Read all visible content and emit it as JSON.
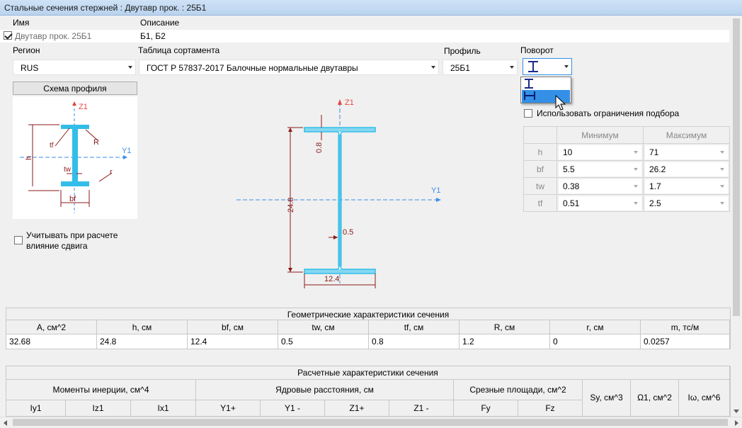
{
  "window": {
    "title": "Стальные сечения стержней : Двутавр прок. : 25Б1"
  },
  "fields": {
    "name_label": "Имя",
    "desc_label": "Описание",
    "name_value": "Двутавр прок. 25Б1",
    "desc_value": "Б1, Б2"
  },
  "region": {
    "label": "Регион",
    "value": "RUS"
  },
  "table": {
    "label": "Таблица сортамента",
    "value": "ГОСТ Р 57837-2017 Балочные нормальные двутавры"
  },
  "profile": {
    "label": "Профиль",
    "value": "25Б1"
  },
  "rotation": {
    "label": "Поворот"
  },
  "scheme": {
    "button": "Схема профиля",
    "z": "Z1",
    "y": "Y1",
    "h": "h",
    "tf": "tf",
    "tw": "tw",
    "R": "R",
    "r": "r",
    "bf": "bf"
  },
  "drawing": {
    "z": "Z1",
    "y": "Y1",
    "flange": "0.8",
    "height": "24.8",
    "web": "0.5",
    "width": "12.4"
  },
  "shear": {
    "label1": "Учитывать при расчете",
    "label2": "влияние сдвига"
  },
  "limits": {
    "use_label": "Использовать ограничения подбора",
    "min_header": "Минимум",
    "max_header": "Максимум",
    "rows": [
      {
        "name": "h",
        "min": "10",
        "max": "71"
      },
      {
        "name": "bf",
        "min": "5.5",
        "max": "26.2"
      },
      {
        "name": "tw",
        "min": "0.38",
        "max": "1.7"
      },
      {
        "name": "tf",
        "min": "0.51",
        "max": "2.5"
      }
    ]
  },
  "geometry": {
    "title": "Геометрические характеристики сечения",
    "headers": [
      "A, см^2",
      "h, см",
      "bf, см",
      "tw, см",
      "tf, см",
      "R, см",
      "r, см",
      "m, тс/м"
    ],
    "values": [
      "32.68",
      "24.8",
      "12.4",
      "0.5",
      "0.8",
      "1.2",
      "0",
      "0.0257"
    ]
  },
  "calc": {
    "title": "Расчетные характеристики сечения",
    "g1": "Моменты инерции, см^4",
    "g2": "Ядровые расстояния, см",
    "g3": "Срезные площади, см^2",
    "sy": "Sy, см^3",
    "o1": "Ω1, см^2",
    "iw": "Iω, см^6",
    "sub": [
      "Iy1",
      "Iz1",
      "Ix1",
      "Y1+",
      "Y1 -",
      "Z1+",
      "Z1 -",
      "Fy",
      "Fz"
    ]
  },
  "colors": {
    "accent": "#3390e6",
    "dim": "#8b1a1a",
    "axis": "#3a8ee6",
    "section": "#33bde8"
  }
}
